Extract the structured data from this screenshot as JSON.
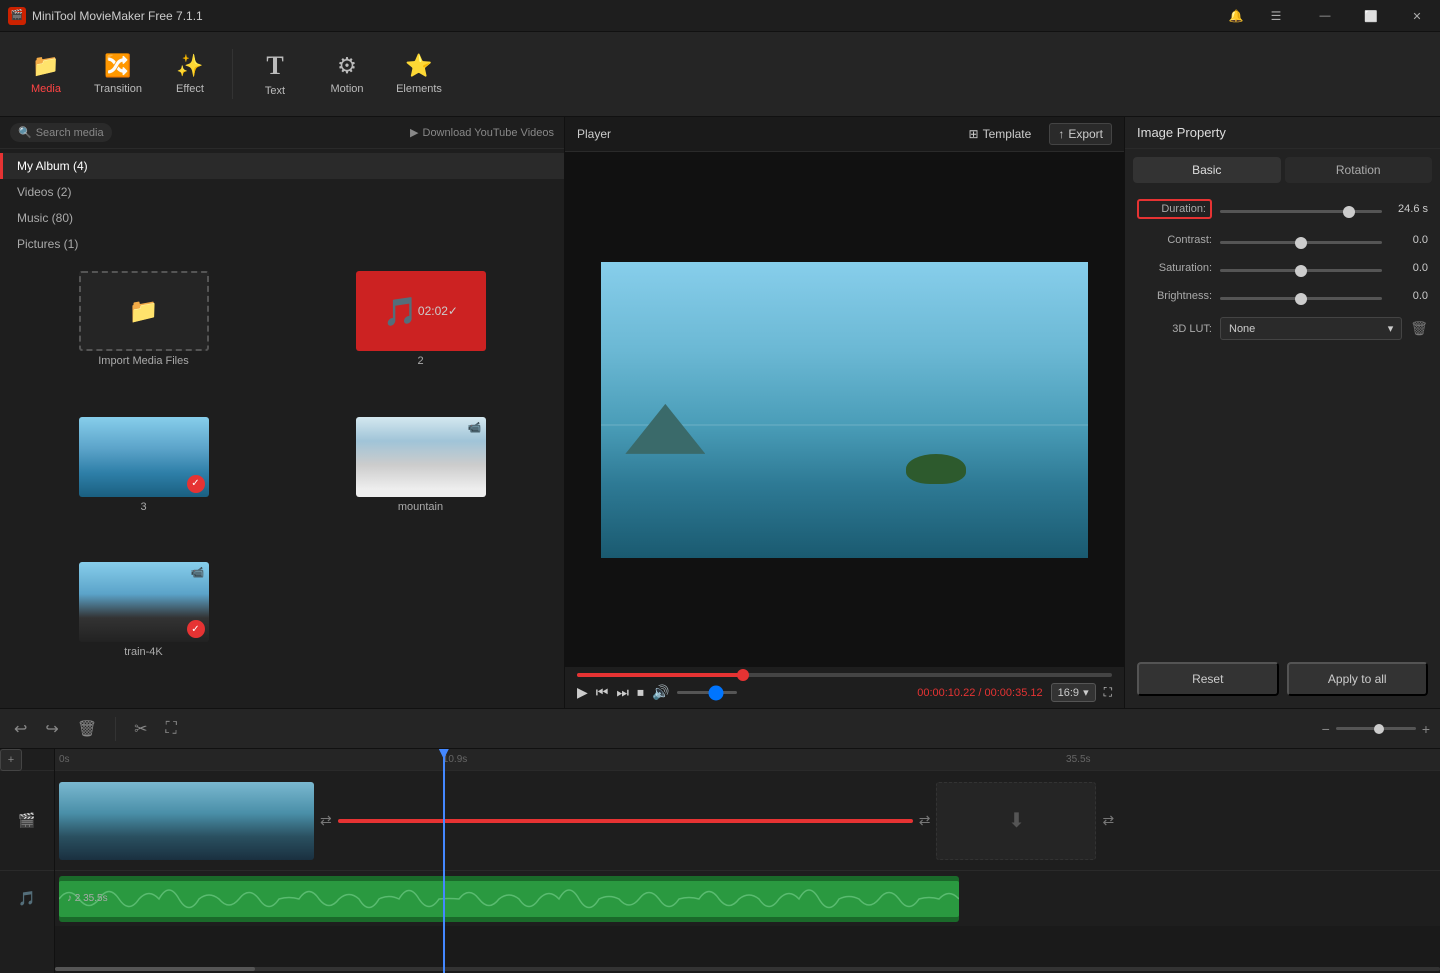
{
  "app": {
    "title": "MiniTool MovieMaker Free 7.1.1",
    "icon": "🎬"
  },
  "titlebar": {
    "minimize_label": "—",
    "maximize_label": "⬜",
    "close_label": "✕"
  },
  "toolbar": {
    "items": [
      {
        "id": "media",
        "label": "Media",
        "icon": "📁",
        "active": true
      },
      {
        "id": "transition",
        "label": "Transition",
        "icon": "🔀"
      },
      {
        "id": "effect",
        "label": "Effect",
        "icon": "✨"
      },
      {
        "id": "text",
        "label": "Text",
        "icon": "T"
      },
      {
        "id": "motion",
        "label": "Motion",
        "icon": "⚙"
      },
      {
        "id": "elements",
        "label": "Elements",
        "icon": "⭐"
      }
    ]
  },
  "left_panel": {
    "search_placeholder": "Search media",
    "download_yt_label": "Download YouTube Videos",
    "albums": [
      {
        "id": "my-album",
        "label": "My Album (4)",
        "active": true
      },
      {
        "id": "videos",
        "label": "Videos (2)"
      },
      {
        "id": "music",
        "label": "Music (80)"
      },
      {
        "id": "pictures",
        "label": "Pictures (1)"
      }
    ],
    "media_items": [
      {
        "id": "import",
        "type": "import",
        "label": "Import Media Files"
      },
      {
        "id": "2",
        "type": "music",
        "label": "2",
        "duration": "02:02",
        "checked": true
      },
      {
        "id": "3",
        "type": "ocean",
        "label": "3",
        "checked": true
      },
      {
        "id": "mountain",
        "type": "mountain",
        "label": "mountain",
        "has_cam": true
      },
      {
        "id": "train-4k",
        "type": "train",
        "label": "train-4K",
        "checked": true,
        "has_cam": true
      }
    ]
  },
  "player": {
    "title": "Player",
    "template_label": "Template",
    "export_label": "Export",
    "current_time": "00:00:10.22",
    "total_time": "00:00:35.12",
    "time_separator": " / ",
    "aspect_ratio": "16:9",
    "progress_percent": 31,
    "volume_percent": 70
  },
  "right_panel": {
    "title": "Image Property",
    "tabs": [
      {
        "id": "basic",
        "label": "Basic",
        "active": true
      },
      {
        "id": "rotation",
        "label": "Rotation"
      }
    ],
    "properties": {
      "duration": {
        "label": "Duration:",
        "value": 24.6,
        "unit": "s",
        "display": "24.6 s",
        "min": 0,
        "max": 30,
        "percent": 82
      },
      "contrast": {
        "label": "Contrast:",
        "value": 0.0,
        "display": "0.0",
        "percent": 50
      },
      "saturation": {
        "label": "Saturation:",
        "value": 0.0,
        "display": "0.0",
        "percent": 50
      },
      "brightness": {
        "label": "Brightness:",
        "value": 0.0,
        "display": "0.0",
        "percent": 50
      },
      "lut_3d": {
        "label": "3D LUT:",
        "options": [
          "None"
        ],
        "selected": "None"
      }
    },
    "reset_label": "Reset",
    "apply_all_label": "Apply to all"
  },
  "timeline": {
    "time_markers": [
      "0s",
      "10.9s",
      "35.5s"
    ],
    "tracks": [
      {
        "id": "video",
        "icon": "🎬"
      },
      {
        "id": "audio",
        "icon": "🎵"
      }
    ],
    "audio_clip": {
      "label": "♪ 2  35.5s"
    },
    "playhead_position_percent": 30
  }
}
